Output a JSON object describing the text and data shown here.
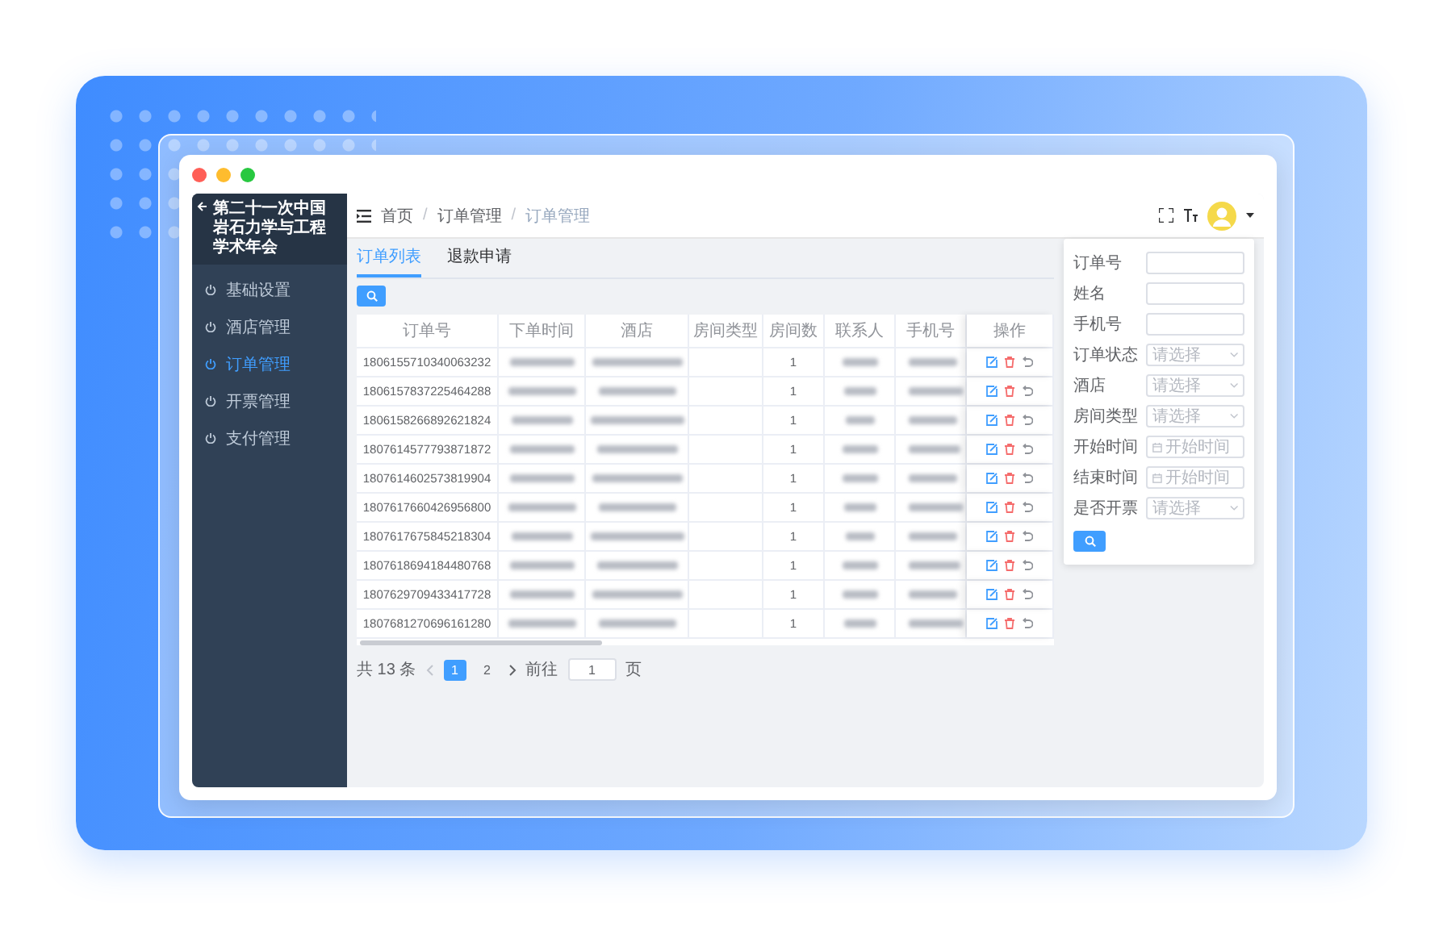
{
  "sidebar": {
    "title": "第二十一次中国岩石力学与工程学术年会",
    "items": [
      {
        "label": "基础设置",
        "selected": false
      },
      {
        "label": "酒店管理",
        "selected": false
      },
      {
        "label": "订单管理",
        "selected": true
      },
      {
        "label": "开票管理",
        "selected": false
      },
      {
        "label": "支付管理",
        "selected": false
      }
    ]
  },
  "breadcrumb": {
    "separator": "/",
    "items": [
      "首页",
      "订单管理",
      "订单管理"
    ]
  },
  "tabs": [
    {
      "label": "订单列表",
      "selected": true
    },
    {
      "label": "退款申请",
      "selected": false
    }
  ],
  "table": {
    "columns": [
      "订单号",
      "下单时间",
      "酒店",
      "房间类型",
      "房间数",
      "联系人",
      "手机号",
      "操作"
    ],
    "rows": [
      {
        "order_no": "1806155710340063232",
        "rooms": "1"
      },
      {
        "order_no": "1806157837225464288",
        "rooms": "1"
      },
      {
        "order_no": "1806158266892621824",
        "rooms": "1"
      },
      {
        "order_no": "1807614577793871872",
        "rooms": "1"
      },
      {
        "order_no": "1807614602573819904",
        "rooms": "1"
      },
      {
        "order_no": "1807617660426956800",
        "rooms": "1"
      },
      {
        "order_no": "1807617675845218304",
        "rooms": "1"
      },
      {
        "order_no": "1807618694184480768",
        "rooms": "1"
      },
      {
        "order_no": "1807629709433417728",
        "rooms": "1"
      },
      {
        "order_no": "1807681270696161280",
        "rooms": "1"
      }
    ]
  },
  "pagination": {
    "total": "共 13 条",
    "pages": [
      {
        "label": "1",
        "selected": true
      },
      {
        "label": "2",
        "selected": false
      }
    ],
    "goto_label": "前往",
    "goto_value": "1",
    "goto_suffix": "页"
  },
  "filters": [
    {
      "label": "订单号",
      "kind": "text"
    },
    {
      "label": "姓名",
      "kind": "text"
    },
    {
      "label": "手机号",
      "kind": "text"
    },
    {
      "label": "订单状态",
      "kind": "select",
      "placeholder": "请选择"
    },
    {
      "label": "酒店",
      "kind": "select",
      "placeholder": "请选择"
    },
    {
      "label": "房间类型",
      "kind": "select",
      "placeholder": "请选择"
    },
    {
      "label": "开始时间",
      "kind": "date",
      "placeholder": "开始时间"
    },
    {
      "label": "结束时间",
      "kind": "date",
      "placeholder": "开始时间"
    },
    {
      "label": "是否开票",
      "kind": "select",
      "placeholder": "请选择"
    }
  ]
}
